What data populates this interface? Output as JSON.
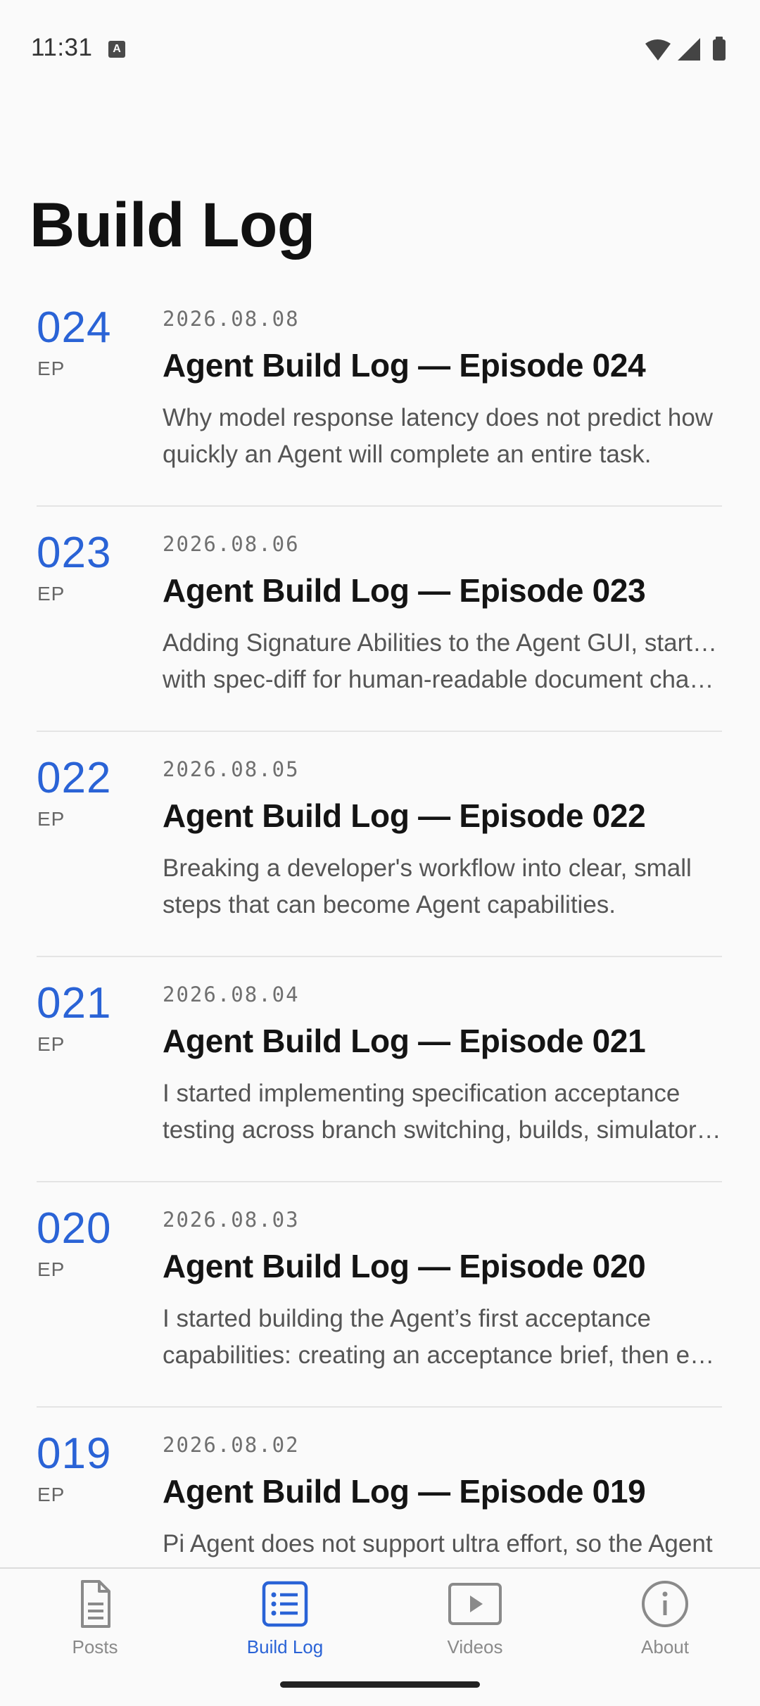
{
  "status": {
    "time": "11:31",
    "badge": "A"
  },
  "page": {
    "title": "Build Log"
  },
  "episodes": [
    {
      "number": "024",
      "label": "EP",
      "date": "2026.08.08",
      "title": "Agent Build Log — Episode 024",
      "summary_lines": [
        "Why model response latency does not predict how",
        "quickly an Agent will complete an entire task."
      ]
    },
    {
      "number": "023",
      "label": "EP",
      "date": "2026.08.06",
      "title": "Agent Build Log — Episode 023",
      "summary_lines": [
        "Adding Signature Abilities to the Agent GUI, starting",
        "with spec-diff for human-readable document chan..."
      ]
    },
    {
      "number": "022",
      "label": "EP",
      "date": "2026.08.05",
      "title": "Agent Build Log — Episode 022",
      "summary_lines": [
        "Breaking a developer's workflow into clear, small",
        "steps that can become Agent capabilities."
      ]
    },
    {
      "number": "021",
      "label": "EP",
      "date": "2026.08.04",
      "title": "Agent Build Log — Episode 021",
      "summary_lines": [
        "I started implementing specification acceptance",
        "testing across branch switching, builds, simulator ..."
      ]
    },
    {
      "number": "020",
      "label": "EP",
      "date": "2026.08.03",
      "title": "Agent Build Log — Episode 020",
      "summary_lines": [
        "I started building the Agent’s first acceptance",
        "capabilities: creating an acceptance brief, then exe..."
      ]
    },
    {
      "number": "019",
      "label": "EP",
      "date": "2026.08.02",
      "title": "Agent Build Log — Episode 019",
      "summary_lines": [
        "Pi Agent does not support ultra effort, so the Agent",
        ""
      ]
    }
  ],
  "nav": {
    "items": [
      {
        "label": "Posts",
        "icon": "document-icon",
        "active": false
      },
      {
        "label": "Build Log",
        "icon": "list-icon",
        "active": true
      },
      {
        "label": "Videos",
        "icon": "play-icon",
        "active": false
      },
      {
        "label": "About",
        "icon": "info-icon",
        "active": false
      }
    ]
  },
  "colors": {
    "accent": "#2a63d6",
    "text": "#141414",
    "muted": "#555555",
    "inactive": "#8a8a8a",
    "background": "#fafafa"
  }
}
